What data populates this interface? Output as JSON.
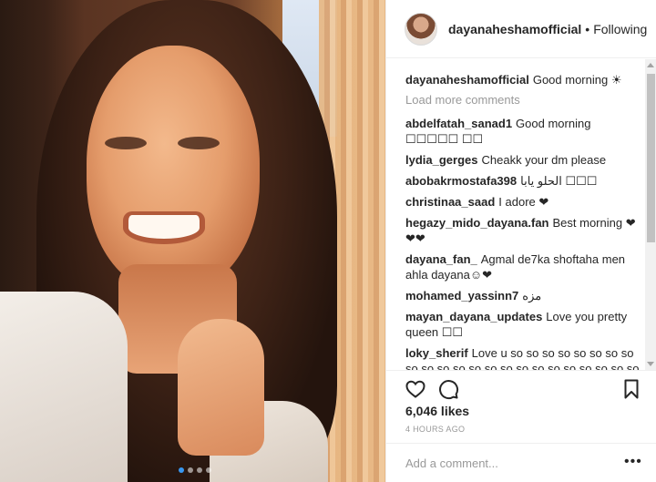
{
  "header": {
    "username": "dayanaheshamofficial",
    "separator": "•",
    "follow_status": "Following"
  },
  "load_more": "Load more comments",
  "comments": [
    {
      "user": "dayanaheshamofficial",
      "text": "Good morning ☀"
    },
    {
      "user": "abdelfatah_sanad1",
      "text": "Good morning ☐☐☐☐☐ ☐☐"
    },
    {
      "user": "lydia_gerges",
      "text": "Cheakk your dm please"
    },
    {
      "user": "abobakrmostafa398",
      "text": "الحلو يابا ☐☐☐"
    },
    {
      "user": "christinaa_saad",
      "text": "I adore ❤"
    },
    {
      "user": "hegazy_mido_dayana.fan",
      "text": "Best morning ❤ ❤❤"
    },
    {
      "user": "dayana_fan_",
      "text": "Agmal de7ka shoftaha men ahla dayana☺❤"
    },
    {
      "user": "mohamed_yassinn7",
      "text": "مزه"
    },
    {
      "user": "mayan_dayana_updates",
      "text": "Love you pretty queen ☐☐"
    },
    {
      "user": "loky_sherif",
      "text": "Love u so so so so so so so so so so so so so so so so so so so so so so so so so so so so so much ❤ ☐ ☐ ❤☐☐"
    }
  ],
  "likes": "6,046 likes",
  "timestamp": "4 HOURS AGO",
  "add_comment_placeholder": "Add a comment...",
  "more_label": "•••",
  "icons": {
    "like": "heart-icon",
    "comment": "comment-icon",
    "save": "bookmark-icon"
  },
  "carousel": {
    "count": 4,
    "active_index": 0
  },
  "colors": {
    "text": "#262626",
    "muted": "#999999",
    "border": "#efefef",
    "accent": "#3897f0"
  }
}
